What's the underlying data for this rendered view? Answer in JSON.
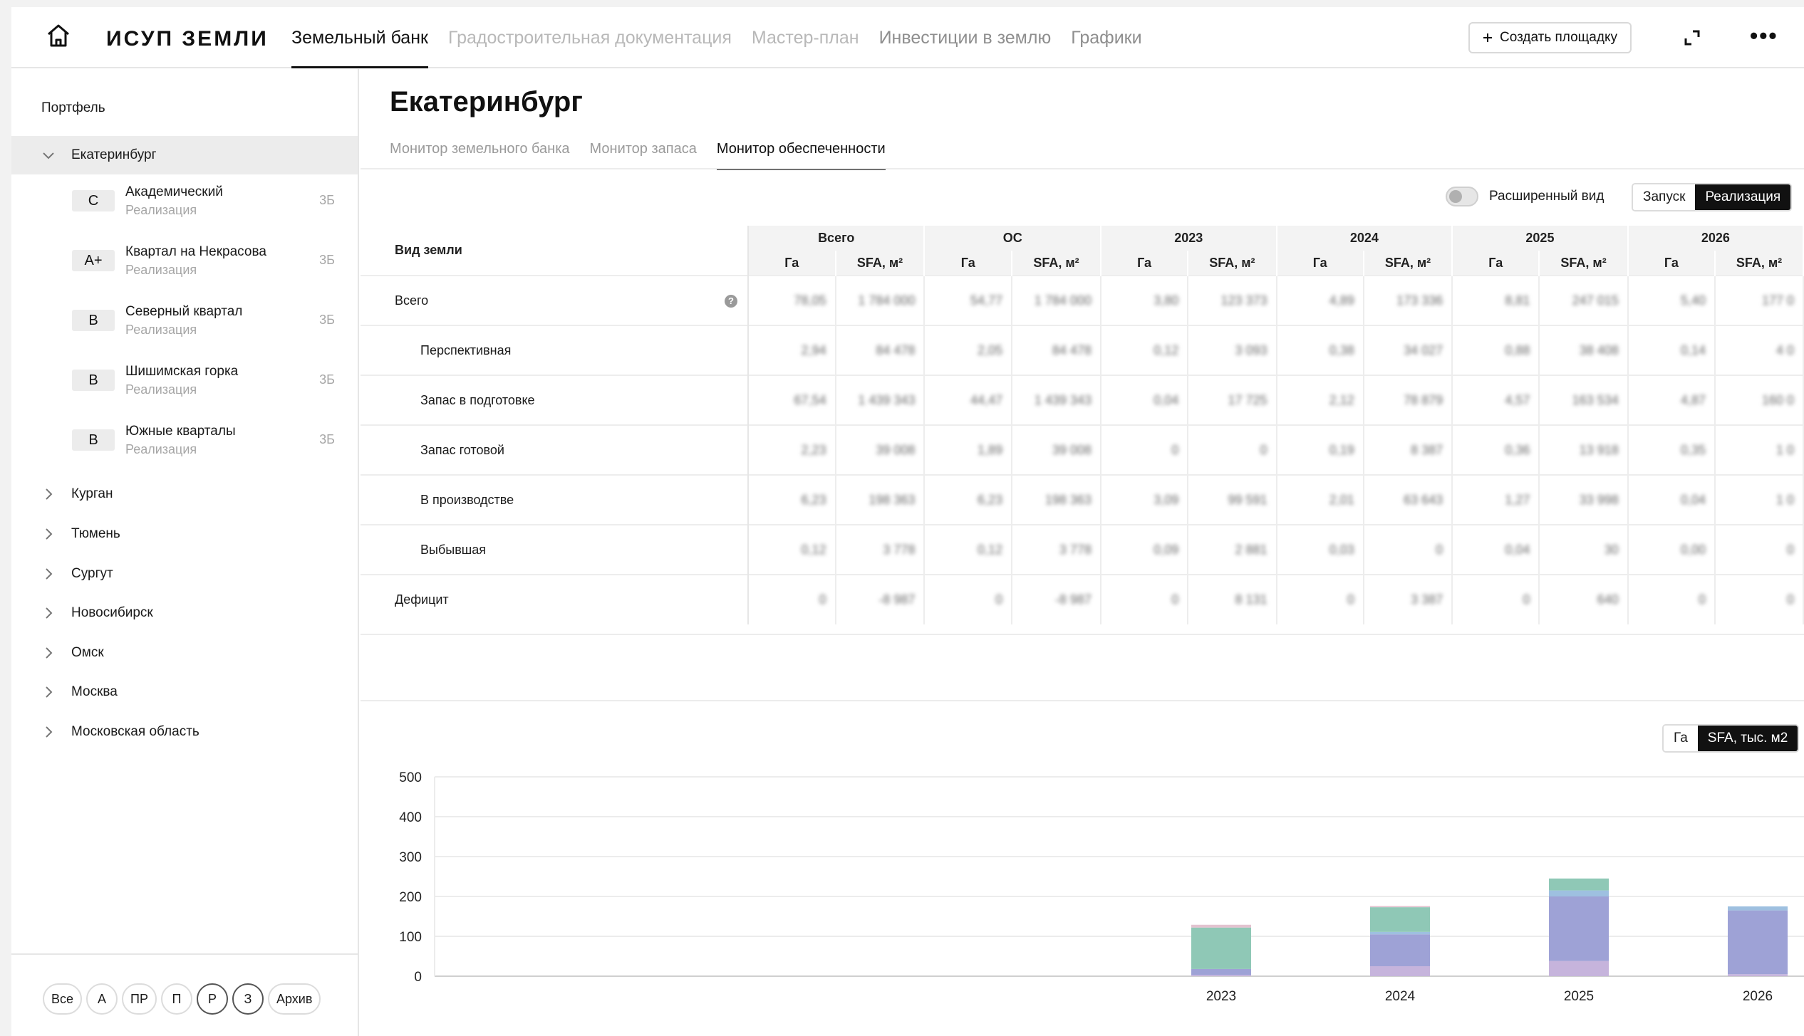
{
  "topbar": {
    "logo": "ИСУП ЗЕМЛИ",
    "nav": [
      {
        "label": "Земельный банк",
        "state": "active"
      },
      {
        "label": "Градостроительная документация",
        "state": "disabled"
      },
      {
        "label": "Мастер-план",
        "state": "disabled"
      },
      {
        "label": "Инвестиции в землю",
        "state": "normal"
      },
      {
        "label": "Графики",
        "state": "normal"
      }
    ],
    "create_label": "Создать площадку",
    "create_icon": "plus-icon"
  },
  "sidebar": {
    "portfolio_label": "Портфель",
    "selected_city": "Екатеринбург",
    "projects": [
      {
        "grade": "C",
        "name": "Академический",
        "status": "Реализация",
        "count": "3Б"
      },
      {
        "grade": "A+",
        "name": "Квартал на Некрасова",
        "status": "Реализация",
        "count": "3Б"
      },
      {
        "grade": "B",
        "name": "Северный квартал",
        "status": "Реализация",
        "count": "3Б"
      },
      {
        "grade": "B",
        "name": "Шишимская горка",
        "status": "Реализация",
        "count": "3Б"
      },
      {
        "grade": "B",
        "name": "Южные кварталы",
        "status": "Реализация",
        "count": "3Б"
      }
    ],
    "cities": [
      "Курган",
      "Тюмень",
      "Сургут",
      "Новосибирск",
      "Омск",
      "Москва",
      "Московская область"
    ],
    "filters": [
      "Все",
      "А",
      "ПР",
      "П",
      "Р",
      "З",
      "Архив"
    ]
  },
  "main": {
    "title": "Екатеринбург",
    "tabs": [
      {
        "label": "Монитор земельного банка",
        "active": false
      },
      {
        "label": "Монитор запаса",
        "active": false
      },
      {
        "label": "Монитор обеспеченности",
        "active": true
      }
    ],
    "extended_view_label": "Расширенный вид",
    "extended_view_on": false,
    "mode": {
      "options": [
        "Запуск",
        "Реализация"
      ],
      "selected": "Реализация"
    },
    "table": {
      "land_type_header": "Вид земли",
      "groups": [
        "Всего",
        "ОС",
        "2023",
        "2024",
        "2025",
        "2026"
      ],
      "subheaders": [
        "Га",
        "SFA, м²"
      ],
      "rows": [
        {
          "label": "Всего",
          "indent": false,
          "help": true,
          "values": [
            "78,05",
            "1 784 000",
            "54,77",
            "1 784 000",
            "3,80",
            "123 373",
            "4,89",
            "173 336",
            "8,81",
            "247 015",
            "5,40",
            "177 0"
          ]
        },
        {
          "label": "Перспективная",
          "indent": true,
          "help": false,
          "values": [
            "2,94",
            "84 478",
            "2,05",
            "84 478",
            "0,12",
            "3 093",
            "0,38",
            "34 027",
            "0,88",
            "38 408",
            "0,14",
            "4 0"
          ]
        },
        {
          "label": "Запас в подготовке",
          "indent": true,
          "help": false,
          "values": [
            "67,54",
            "1 439 343",
            "44,47",
            "1 439 343",
            "0,04",
            "17 725",
            "2,12",
            "78 879",
            "4,57",
            "163 534",
            "4,87",
            "160 0"
          ]
        },
        {
          "label": "Запас готовой",
          "indent": true,
          "help": false,
          "values": [
            "2,23",
            "39 008",
            "1,89",
            "39 008",
            "0",
            "0",
            "0,19",
            "8 387",
            "0,36",
            "13 918",
            "0,35",
            "1 0"
          ]
        },
        {
          "label": "В производстве",
          "indent": true,
          "help": false,
          "values": [
            "6,23",
            "198 363",
            "6,23",
            "198 363",
            "3,09",
            "99 591",
            "2,01",
            "63 643",
            "1,27",
            "33 998",
            "0,04",
            "1 0"
          ]
        },
        {
          "label": "Выбывшая",
          "indent": true,
          "help": false,
          "values": [
            "0,12",
            "3 778",
            "0,12",
            "3 778",
            "0,09",
            "2 881",
            "0,03",
            "0",
            "0,04",
            "30",
            "0,00",
            "0"
          ]
        },
        {
          "label": "Дефицит",
          "indent": false,
          "help": false,
          "values": [
            "0",
            "-8 987",
            "0",
            "-8 987",
            "0",
            "8 131",
            "0",
            "3 387",
            "0",
            "640",
            "0",
            "0"
          ]
        }
      ]
    },
    "chart_units": {
      "options": [
        "Га",
        "SFA, тыс. м2"
      ],
      "selected": "SFA, тыс. м2"
    }
  },
  "chart_data": {
    "type": "bar",
    "stacked": true,
    "categories": [
      "2023",
      "2024",
      "2025",
      "2026"
    ],
    "ylim": [
      0,
      500
    ],
    "yticks": [
      0,
      100,
      200,
      300,
      400,
      500
    ],
    "grid": true,
    "series": [
      {
        "color": "#c6b4dc",
        "values": [
          3,
          25,
          38,
          5
        ]
      },
      {
        "color": "#9ea2d6",
        "values": [
          15,
          80,
          162,
          160
        ]
      },
      {
        "color": "#9ec0e0",
        "values": [
          0,
          6,
          15,
          10
        ]
      },
      {
        "color": "#8fc8b6",
        "values": [
          104,
          62,
          30,
          0
        ]
      },
      {
        "color": "#e3c3d0",
        "values": [
          7,
          3,
          0,
          0
        ]
      }
    ]
  }
}
